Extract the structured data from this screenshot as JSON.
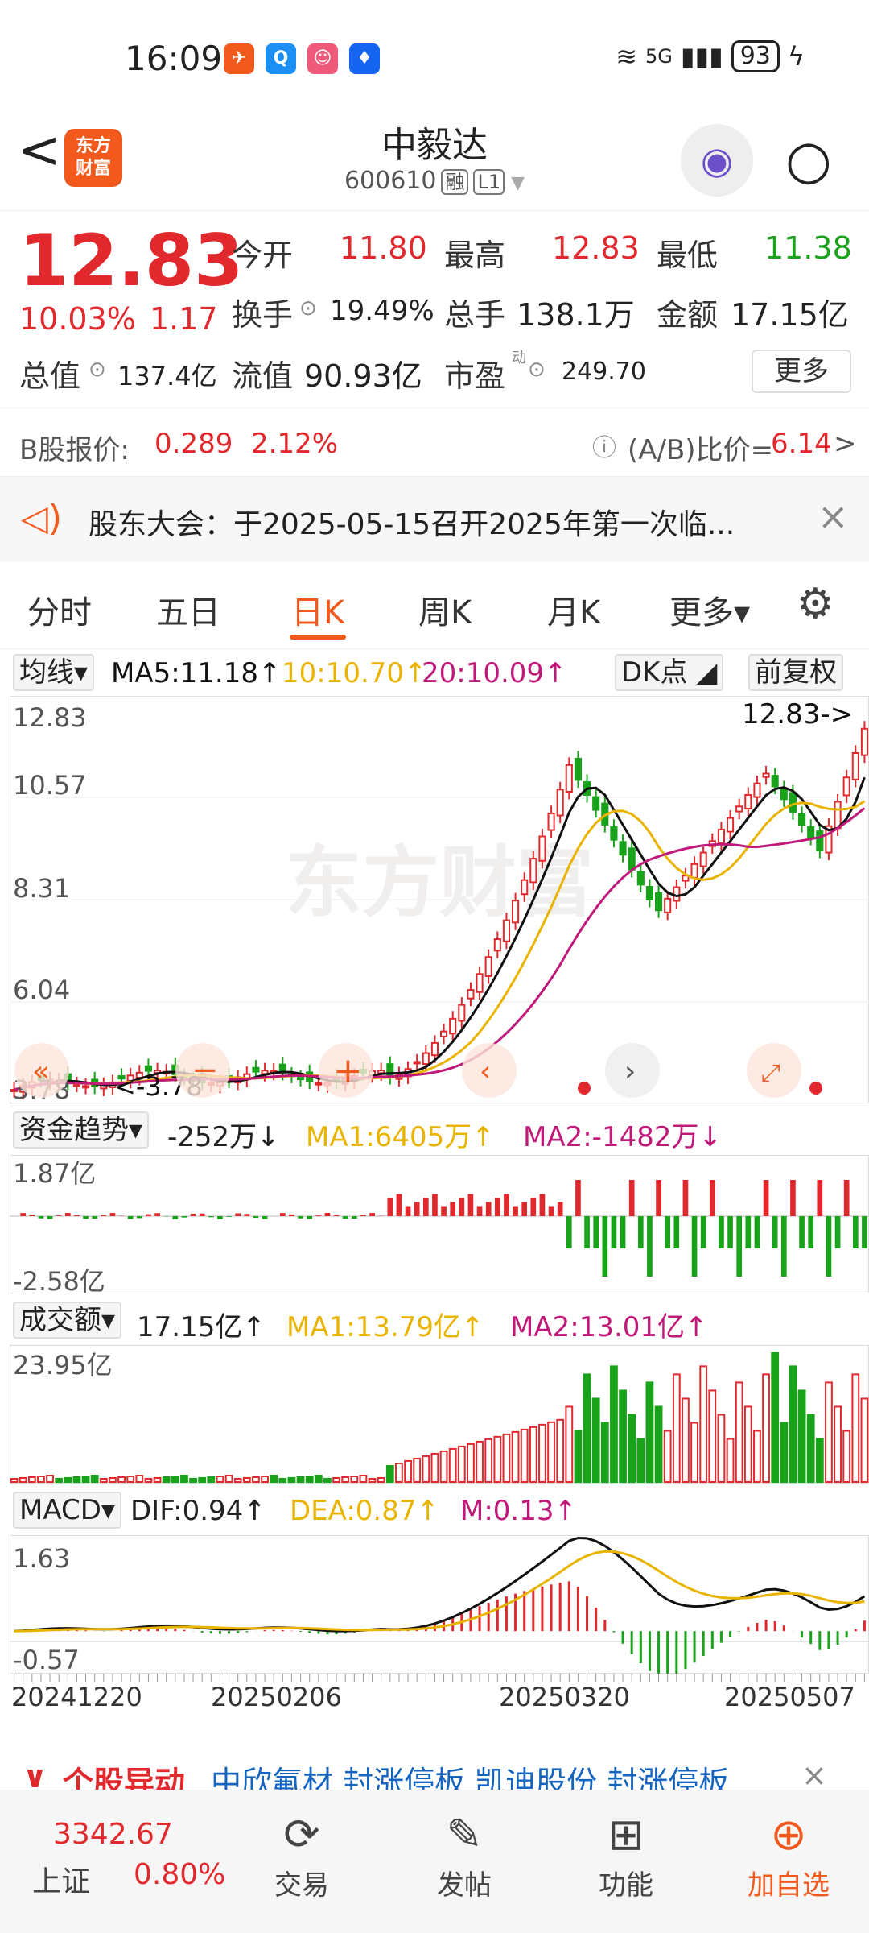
{
  "status_bar": {
    "time": "16:09",
    "battery": "93",
    "network": "5G"
  },
  "header": {
    "back": "<",
    "logo": "东方财富",
    "title": "中毅达",
    "code": "600610",
    "tag_margin": "融",
    "tag_level": "L1"
  },
  "quote": {
    "price": "12.83",
    "change_pct": "10.03%",
    "change": "1.17",
    "open_label": "今开",
    "open": "11.80",
    "high_label": "最高",
    "high": "12.83",
    "low_label": "最低",
    "low": "11.38",
    "turnover_label": "换手",
    "turnover": "19.49%",
    "volume_label": "总手",
    "volume": "138.1万",
    "amount_label": "金额",
    "amount": "17.15亿",
    "mcap_label": "总值",
    "mcap": "137.4亿",
    "float_label": "流值",
    "float": "90.93亿",
    "pe_label": "市盈",
    "pe_sup": "动",
    "pe": "249.70",
    "more": "更多"
  },
  "bshare": {
    "label": "B股报价:",
    "price": "0.289",
    "pct": "2.12%",
    "ratio_label": "(A/B)比价=",
    "ratio": "6.14",
    "arrow": ">"
  },
  "notice": {
    "text": "股东大会：于2025-05-15召开2025年第一次临..."
  },
  "tabs": [
    "分时",
    "五日",
    "日K",
    "周K",
    "月K",
    "更多▾"
  ],
  "kline": {
    "ma_select": "均线▾",
    "ma5": "MA5:11.18↑",
    "ma10": "10:10.70↑",
    "ma20": "20:10.09↑",
    "dk": "DK点",
    "adjust": "前复权",
    "y_ticks": [
      "12.83",
      "10.57",
      "8.31",
      "6.04",
      "3.78"
    ],
    "max_label": "12.83->",
    "min_label": "<-3.78",
    "watermark": "东方财富"
  },
  "fund": {
    "select": "资金趋势▾",
    "value": "-252万↓",
    "ma1": "MA1:6405万↑",
    "ma2": "MA2:-1482万↓",
    "top": "1.87亿",
    "bottom": "-2.58亿"
  },
  "vol": {
    "select": "成交额▾",
    "value": "17.15亿↑",
    "ma1": "MA1:13.79亿↑",
    "ma2": "MA2:13.01亿↑",
    "top": "23.95亿"
  },
  "macd": {
    "select": "MACD▾",
    "dif": "DIF:0.94↑",
    "dea": "DEA:0.87↑",
    "m": "M:0.13↑",
    "top": "1.63",
    "bottom": "-0.57"
  },
  "x_dates": [
    "20241220",
    "20250206",
    "20250320",
    "20250507"
  ],
  "ticker": {
    "prefix": "个股异动",
    "text": "中欣氟材 封涨停板 凯迪股份 封涨停板"
  },
  "nav": {
    "index_value": "3342.67",
    "index_name": "上证",
    "index_pct": "0.80%",
    "trade": "交易",
    "post": "发帖",
    "func": "功能",
    "add": "加自选"
  },
  "colors": {
    "up": "#e0282d",
    "down": "#18a31a",
    "brand": "#f25a1d",
    "ma5": "#111111",
    "ma10": "#e8b400",
    "ma20": "#c0197a"
  }
}
